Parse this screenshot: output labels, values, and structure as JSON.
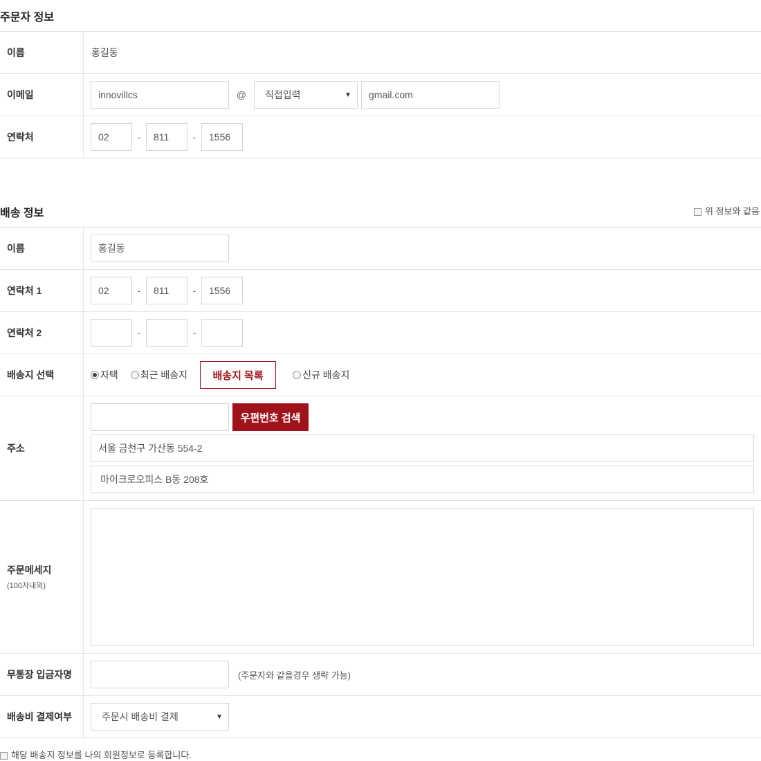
{
  "orderer": {
    "title": "주문자 정보",
    "name_label": "이름",
    "name_value": "홍길동",
    "email_label": "이메일",
    "email_id": "innovillcs",
    "at": "@",
    "email_domain_select": "직접입력",
    "email_domain": "gmail.com",
    "phone_label": "연락처",
    "phone": [
      "02",
      "811",
      "1556"
    ],
    "dash": "-"
  },
  "shipping": {
    "title": "배송 정보",
    "same_as_above": "위 정보와 같음",
    "name_label": "이름",
    "name_value": "홍길동",
    "phone1_label": "연락처 1",
    "phone1": [
      "02",
      "811",
      "1556"
    ],
    "phone2_label": "연락처 2",
    "phone2": [
      "",
      "",
      ""
    ],
    "dest_label": "배송지 선택",
    "dest_options": {
      "home": "자택",
      "recent": "최근 배송지",
      "list_button": "배송지 목록",
      "new": "신규 배송지"
    },
    "address_label": "주소",
    "zipcode": "",
    "zip_search_button": "우편번호 검색",
    "address1": "서울 금천구 가산동 554-2",
    "address2": "마이크로오피스 B동 208호",
    "message_label": "주문메세지",
    "message_sublabel": "(100자내외)",
    "message": "",
    "depositor_label": "무통장 입금자명",
    "depositor": "",
    "depositor_note": "(주문자와 같을경우 생략 가능)",
    "fee_label": "배송비 결제여부",
    "fee_select": "주문시 배송비 결제",
    "register_check": "해당 배송지 정보를 나의 회원정보로 등록합니다."
  },
  "colors": {
    "accent": "#a0121a",
    "border": "#e3e3e3"
  }
}
